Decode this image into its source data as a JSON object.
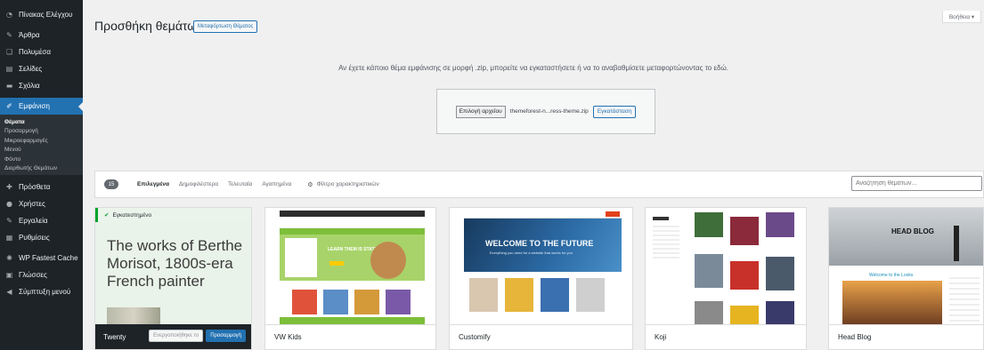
{
  "colors": {
    "sidebar": "#1d2327",
    "accent": "#2271b1",
    "success": "#00a32a"
  },
  "sidebar": {
    "items": [
      {
        "label": "Πίνακας Ελέγχου",
        "icon": "dashboard-icon",
        "glyph": "◔"
      },
      {
        "label": "Άρθρα",
        "icon": "pin-icon",
        "glyph": "✎"
      },
      {
        "label": "Πολυμέσα",
        "icon": "media-icon",
        "glyph": "❏"
      },
      {
        "label": "Σελίδες",
        "icon": "pages-icon",
        "glyph": "▤"
      },
      {
        "label": "Σχόλια",
        "icon": "comments-icon",
        "glyph": "▬"
      },
      {
        "label": "Εμφάνιση",
        "icon": "appearance-icon",
        "glyph": "✐"
      },
      {
        "label": "Πρόσθετα",
        "icon": "plugins-icon",
        "glyph": "✚"
      },
      {
        "label": "Χρήστες",
        "icon": "users-icon",
        "glyph": "●"
      },
      {
        "label": "Εργαλεία",
        "icon": "tools-icon",
        "glyph": "✎"
      },
      {
        "label": "Ρυθμίσεις",
        "icon": "settings-icon",
        "glyph": "▦"
      },
      {
        "label": "WP Fastest Cache",
        "icon": "cache-icon",
        "glyph": "✺"
      },
      {
        "label": "Γλώσσες",
        "icon": "languages-icon",
        "glyph": "▣"
      },
      {
        "label": "Σύμπτυξη μενού",
        "icon": "collapse-icon",
        "glyph": "◀"
      }
    ],
    "submenu": [
      "Θέματα",
      "Προσαρμογή",
      "Μικροεφαρμογές",
      "Μενού",
      "Φόντο",
      "Διορθωτής Θεμάτων"
    ]
  },
  "header": {
    "title": "Προσθήκη θεμάτων",
    "upload_button": "Μεταφόρτωση Θέματος",
    "help": "Βοήθεια ▾"
  },
  "upload": {
    "description": "Αν έχετε κάποιο θέμα εμφάνισης σε μορφή .zip, μπορείτε να εγκαταστήσετε ή να το αναβαθμίσετε μεταφορτώνοντας το εδώ.",
    "choose_file": "Επιλογή αρχείου",
    "file_name": "themeforest-n...ress-theme.zip",
    "install": "Εγκατάσταση"
  },
  "filters": {
    "count": "15",
    "tabs": [
      "Επιλεγμένα",
      "Δημοφιλέστερα",
      "Τελευταία",
      "Αγαπημένα"
    ],
    "feature_filter": "Φίλτρο χαρακτηριστικών",
    "search_placeholder": "Αναζήτηση θεμάτων..."
  },
  "themes": [
    {
      "name": "Twenty",
      "installed": "Εγκατεστημένο",
      "preview_text": "The works of Berthe Morisot, 1800s-era French painter",
      "activate": "Ενεργοποιήθηκε το",
      "customize": "Προσαρμογή"
    },
    {
      "name": "VW Kids",
      "banner": "LEARN THEM IS STATIC!"
    },
    {
      "name": "Customify",
      "banner": "WELCOME TO THE FUTURE",
      "sub": "Everything you need for a website that works for you"
    },
    {
      "name": "Koji"
    },
    {
      "name": "Head Blog",
      "banner": "HEAD BLOG",
      "sub": "Welcome to the Looks"
    }
  ]
}
